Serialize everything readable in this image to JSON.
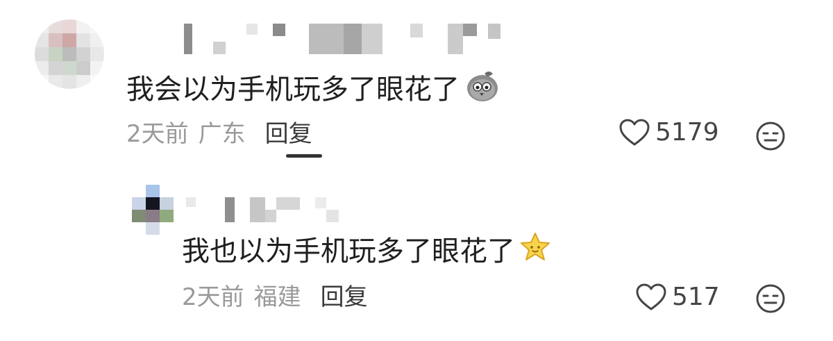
{
  "comments": [
    {
      "text": "我会以为手机玩多了眼花了",
      "emoji": "crying-pigeon-icon",
      "time": "2天前",
      "location": "广东",
      "reply_label": "回复",
      "likes": "5179"
    },
    {
      "text": "我也以为手机玩多了眼花了",
      "emoji": "star-icon",
      "time": "2天前",
      "location": "福建",
      "reply_label": "回复",
      "likes": "517"
    }
  ],
  "colors": {
    "text": "#1f1f1f",
    "meta": "#9a9a9a",
    "reply": "#3a3a3a",
    "icon": "#444444"
  }
}
